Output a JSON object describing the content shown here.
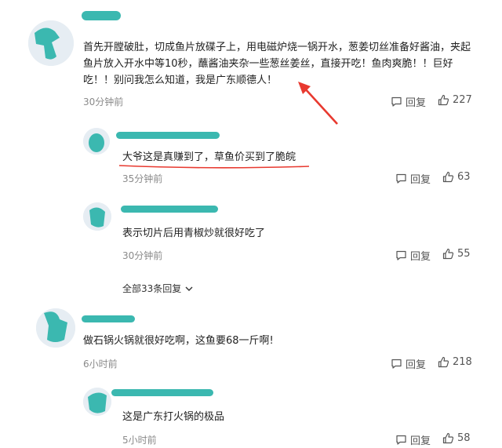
{
  "comments": [
    {
      "text": "首先开膛破肚，切成鱼片放碟子上，用电磁炉烧一锅开水，葱姜切丝准备好酱油，夹起鱼片放入开水中等10秒，蘸酱油夹杂一些葱丝姜丝，直接开吃！鱼肉爽脆！！巨好吃！！别问我怎么知道，我是广东顺德人！",
      "time": "30分钟前",
      "reply": "回复",
      "likes": "227"
    },
    {
      "text": "大爷这是真赚到了，草鱼价买到了脆皖",
      "time": "35分钟前",
      "reply": "回复",
      "likes": "63"
    },
    {
      "text": "表示切片后用青椒炒就很好吃了",
      "time": "30分钟前",
      "reply": "回复",
      "likes": "55"
    },
    {
      "text": "做石锅火锅就很好吃啊，这鱼要68一斤啊!",
      "time": "6小时前",
      "reply": "回复",
      "likes": "218"
    },
    {
      "text": "这是广东打火锅的极品",
      "time": "5小时前",
      "reply": "回复",
      "likes": "58"
    }
  ],
  "more_replies": "全部33条回复",
  "colors": {
    "annotation_red": "#e8392f",
    "scribble_teal": "#3bb8b0"
  }
}
